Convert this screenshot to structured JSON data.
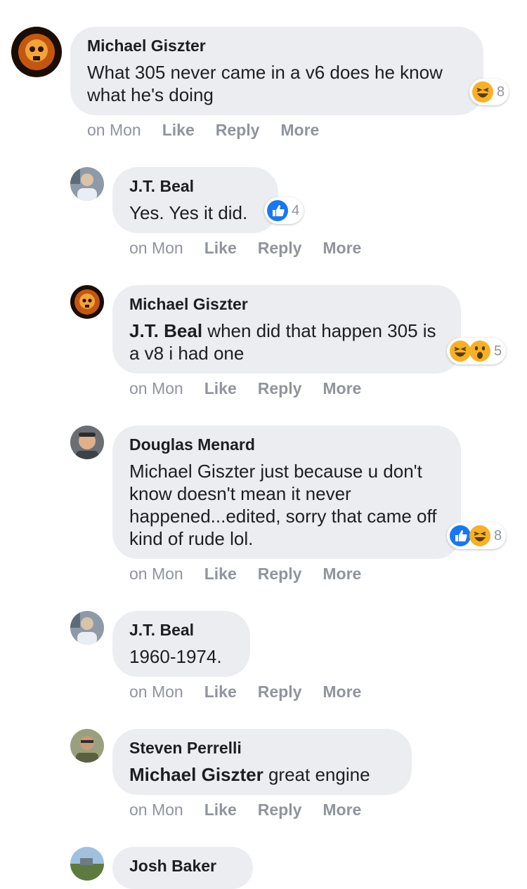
{
  "actions": {
    "time": "on Mon",
    "like": "Like",
    "reply": "Reply",
    "more": "More"
  },
  "comments": [
    {
      "author": "Michael Giszter",
      "mention": "",
      "text": "What 305 never came in a v6 does he know what he's doing",
      "reactions": [
        "haha"
      ],
      "reaction_count": "8"
    },
    {
      "author": "J.T. Beal",
      "mention": "",
      "text": "Yes. Yes it did.",
      "reactions": [
        "like"
      ],
      "reaction_count": "4"
    },
    {
      "author": "Michael Giszter",
      "mention": "J.T. Beal",
      "text": "when did that happen 305 is a v8 i had one",
      "reactions": [
        "haha",
        "wow"
      ],
      "reaction_count": "5"
    },
    {
      "author": "Douglas Menard",
      "mention": "",
      "text": "Michael Giszter just because u don't know doesn't mean it never happened...edited, sorry that came off kind of rude lol.",
      "reactions": [
        "like",
        "haha"
      ],
      "reaction_count": "8"
    },
    {
      "author": "J.T. Beal",
      "mention": "",
      "text": "1960-1974.",
      "reactions": [],
      "reaction_count": ""
    },
    {
      "author": "Steven Perrelli",
      "mention": "Michael Giszter",
      "text": "great engine",
      "reactions": [],
      "reaction_count": ""
    },
    {
      "author": "Josh Baker",
      "mention": "",
      "text": "",
      "reactions": [],
      "reaction_count": ""
    }
  ],
  "colors": {
    "bubble": "#ebedf0",
    "meta": "#90949c",
    "like_blue": "#1877f2",
    "haha_yellow": "#f7b125"
  }
}
